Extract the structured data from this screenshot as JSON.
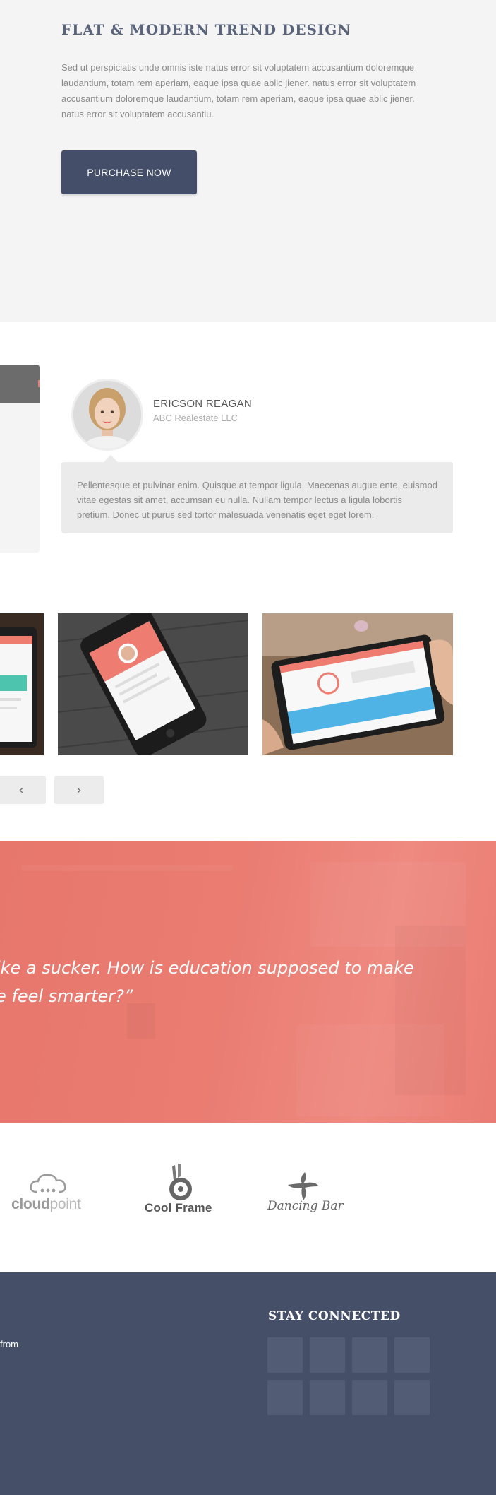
{
  "hero": {
    "title": "FLAT & MODERN TREND DESIGN",
    "text": "Sed ut perspiciatis unde omnis iste natus error sit voluptatem accusantium doloremque laudantium, totam rem aperiam, eaque ipsa quae ablic jiener. natus error sit voluptatem accusantium doloremque laudantium, totam rem aperiam, eaque ipsa quae ablic jiener. natus error sit voluptatem accusantiu.",
    "button_label": "PURCHASE NOW"
  },
  "testimonial": {
    "name": "ERICSON REAGAN",
    "company": "ABC Realestate LLC",
    "text": "Pellentesque et pulvinar enim. Quisque at tempor ligula. Maecenas augue ente, euismod vitae egestas sit amet, accumsan eu nulla. Nullam tempor lectus a ligula lobortis pretium. Donec ut purus sed tortor malesuada venenatis eget eget lorem."
  },
  "gallery": {
    "prev_icon": "‹",
    "next_icon": "›"
  },
  "quote": {
    "text": "ike a sucker. How is education supposed to make\ne feel smarter?”"
  },
  "logos": {
    "cloud_bold": "cloud",
    "cloud_light": "point",
    "coolframe": "Cool Frame",
    "dancing": "Dancing Bar"
  },
  "footer": {
    "from_text": "from",
    "stay_connected": "STAY CONNECTED"
  },
  "colors": {
    "navy": "#444e68",
    "coral": "#ea7c72",
    "footer_bg": "#455068",
    "tile": "#525d75"
  }
}
